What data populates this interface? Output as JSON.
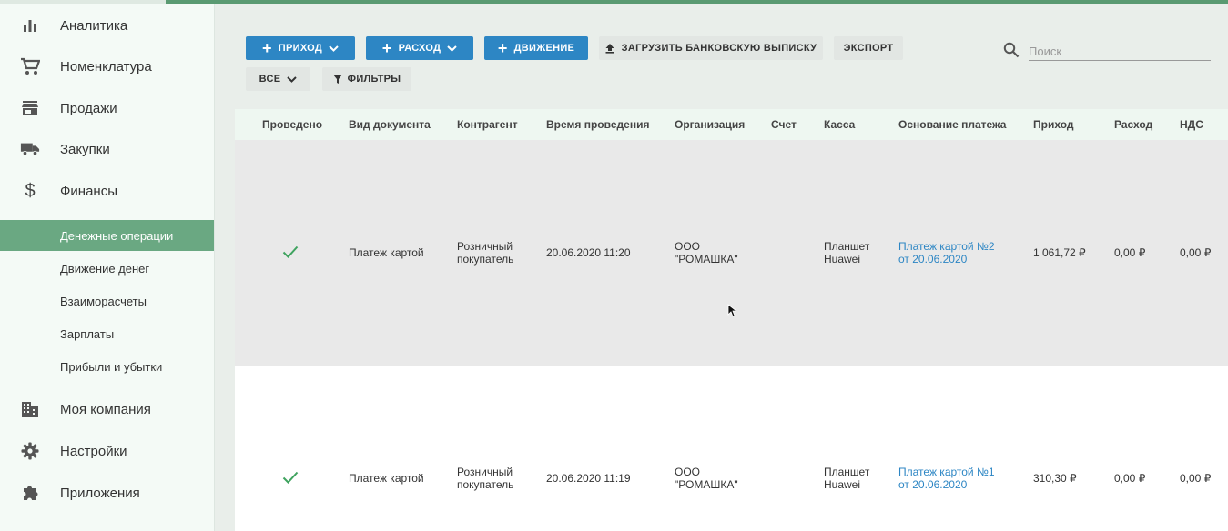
{
  "sidebar": {
    "items": [
      {
        "label": "Аналитика",
        "icon": "bar-chart-icon"
      },
      {
        "label": "Номенклатура",
        "icon": "cart-icon"
      },
      {
        "label": "Продажи",
        "icon": "store-icon"
      },
      {
        "label": "Закупки",
        "icon": "truck-icon"
      },
      {
        "label": "Финансы",
        "icon": "dollar-icon"
      }
    ],
    "sub_items": [
      {
        "label": "Денежные операции",
        "active": true
      },
      {
        "label": "Движение денег"
      },
      {
        "label": "Взаиморасчеты"
      },
      {
        "label": "Зарплаты"
      },
      {
        "label": "Прибыли и убытки"
      }
    ],
    "bottom_items": [
      {
        "label": "Моя компания",
        "icon": "building-icon"
      },
      {
        "label": "Настройки",
        "icon": "gear-icon"
      },
      {
        "label": "Приложения",
        "icon": "puzzle-icon"
      }
    ]
  },
  "toolbar": {
    "income_label": "ПРИХОД",
    "expense_label": "РАСХОД",
    "movement_label": "ДВИЖЕНИЕ",
    "upload_label": "ЗАГРУЗИТЬ БАНКОВСКУЮ ВЫПИСКУ",
    "export_label": "ЭКСПОРТ",
    "all_label": "ВСЕ",
    "filters_label": "ФИЛЬТРЫ",
    "search_placeholder": "Поиск"
  },
  "table": {
    "headers": [
      "Проведено",
      "Вид документа",
      "Контрагент",
      "Время проведения",
      "Организация",
      "Счет",
      "Касса",
      "Основание платежа",
      "Приход",
      "Расход",
      "НДС"
    ],
    "rows": [
      {
        "posted": true,
        "doc_type": "Платеж картой",
        "counterparty_1": "Розничный",
        "counterparty_2": "покупатель",
        "time": "20.06.2020 11:20",
        "org_1": "ООО",
        "org_2": "\"РОМАШКА\"",
        "account": "",
        "cashbox_1": "Планшет",
        "cashbox_2": "Huawei",
        "basis_1": "Платеж картой №2",
        "basis_2": "от 20.06.2020",
        "income": "1 061,72 ₽",
        "expense": "0,00 ₽",
        "vat": "0,00 ₽"
      },
      {
        "posted": true,
        "doc_type": "Платеж картой",
        "counterparty_1": "Розничный",
        "counterparty_2": "покупатель",
        "time": "20.06.2020 11:19",
        "org_1": "ООО",
        "org_2": "\"РОМАШКА\"",
        "account": "",
        "cashbox_1": "Планшет",
        "cashbox_2": "Huawei",
        "basis_1": "Платеж картой №1",
        "basis_2": "от 20.06.2020",
        "income": "310,30 ₽",
        "expense": "0,00 ₽",
        "vat": "0,00 ₽"
      }
    ]
  }
}
